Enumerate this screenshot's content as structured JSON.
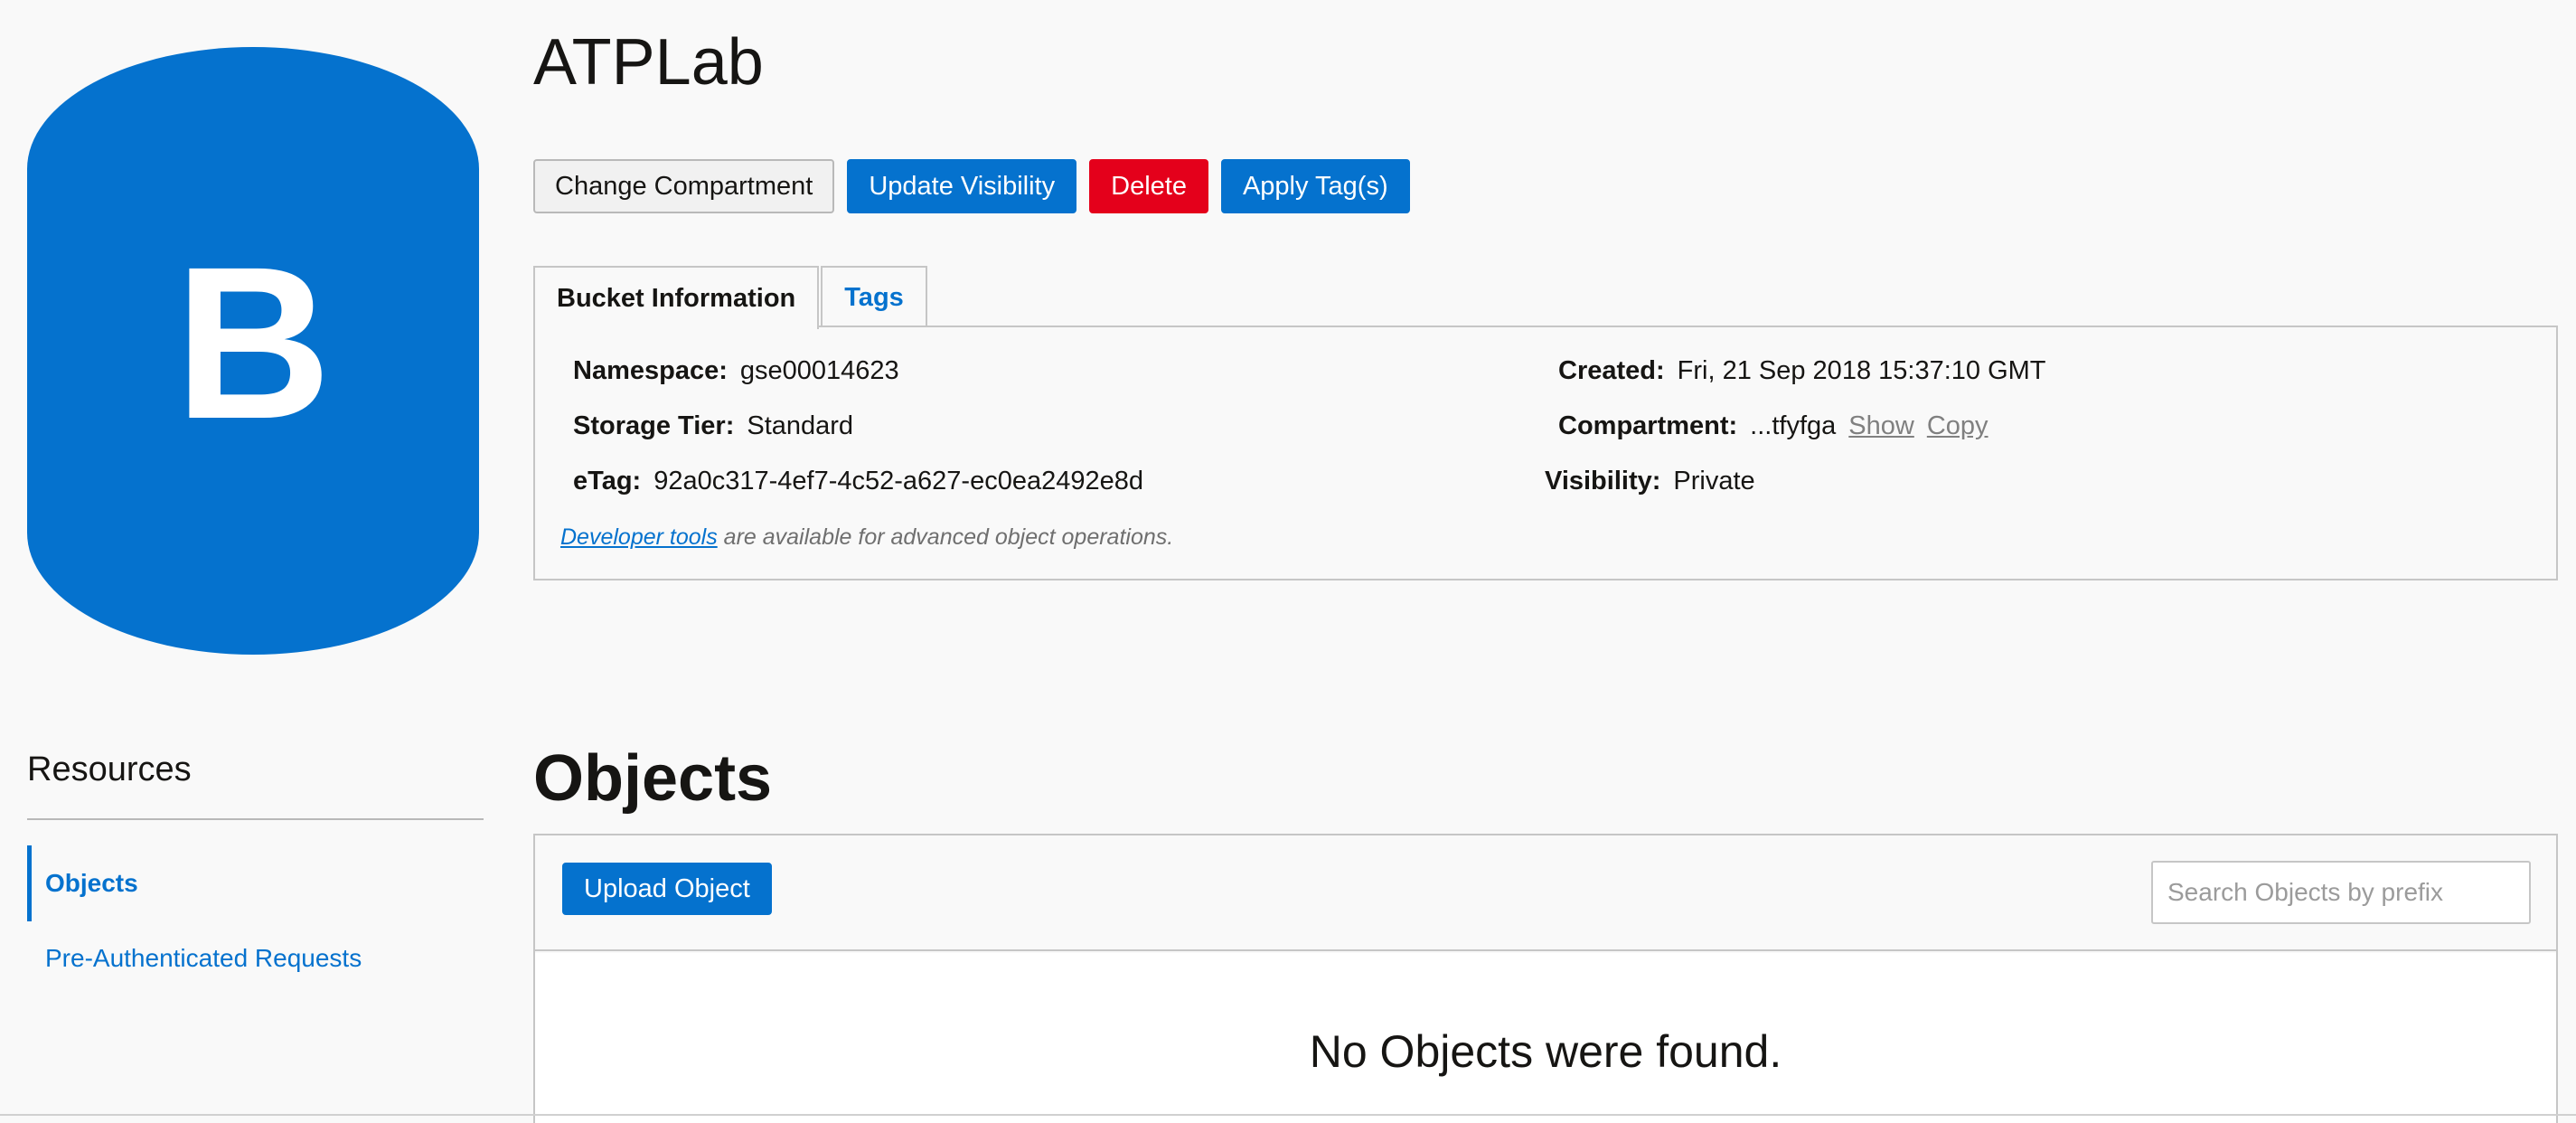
{
  "bucket": {
    "icon_letter": "B",
    "name": "ATPLab",
    "badge_color": "#0572ce"
  },
  "actions": {
    "change_compartment": "Change Compartment",
    "update_visibility": "Update Visibility",
    "delete": "Delete",
    "apply_tags": "Apply Tag(s)"
  },
  "tabs": [
    {
      "label": "Bucket Information",
      "active": true
    },
    {
      "label": "Tags",
      "active": false
    }
  ],
  "info": {
    "namespace_label": "Namespace:",
    "namespace_value": "gse00014623",
    "storage_tier_label": "Storage Tier:",
    "storage_tier_value": "Standard",
    "etag_label": "eTag:",
    "etag_value": "92a0c317-4ef7-4c52-a627-ec0ea2492e8d",
    "created_label": "Created:",
    "created_value": "Fri, 21 Sep 2018 15:37:10 GMT",
    "compartment_label": "Compartment:",
    "compartment_value": "...tfyfga",
    "compartment_show": "Show",
    "compartment_copy": "Copy",
    "visibility_label": "Visibility:",
    "visibility_value": "Private",
    "dev_tools_link": "Developer tools",
    "dev_tools_text": " are available for advanced object operations."
  },
  "resources": {
    "title": "Resources",
    "items": [
      {
        "label": "Objects",
        "active": true
      },
      {
        "label": "Pre-Authenticated Requests",
        "active": false
      }
    ]
  },
  "objects": {
    "title": "Objects",
    "upload_label": "Upload Object",
    "search_placeholder": "Search Objects by prefix",
    "empty_message": "No Objects were found."
  }
}
